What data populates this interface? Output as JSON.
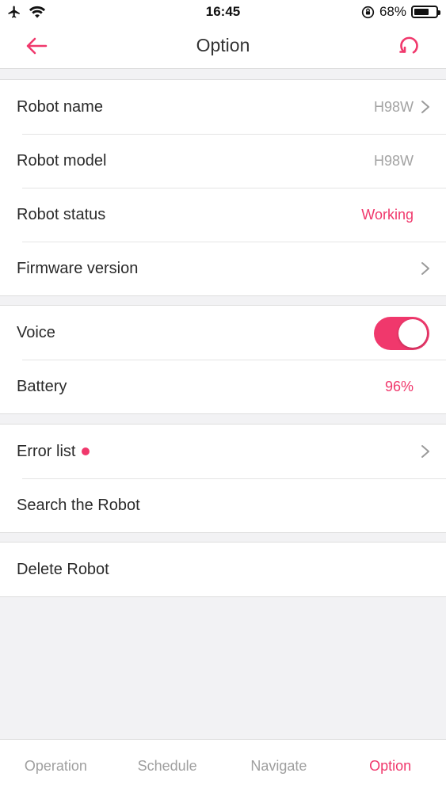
{
  "status_bar": {
    "time": "16:45",
    "battery_text": "68%",
    "battery_level": 0.68,
    "icons": [
      "airplane-icon",
      "wifi-icon",
      "orientation-lock-icon",
      "battery-icon"
    ]
  },
  "nav": {
    "title": "Option",
    "back_icon": "arrow-left-icon",
    "refresh_icon": "refresh-icon"
  },
  "sections": {
    "robot": {
      "name_label": "Robot name",
      "name_value": "H98W",
      "model_label": "Robot model",
      "model_value": "H98W",
      "status_label": "Robot status",
      "status_value": "Working",
      "firmware_label": "Firmware version"
    },
    "settings": {
      "voice_label": "Voice",
      "voice_on": true,
      "battery_label": "Battery",
      "battery_value": "96%"
    },
    "support": {
      "error_label": "Error list",
      "search_label": "Search the Robot"
    },
    "danger": {
      "delete_label": "Delete Robot"
    }
  },
  "tabs": [
    {
      "label": "Operation",
      "active": false
    },
    {
      "label": "Schedule",
      "active": false
    },
    {
      "label": "Navigate",
      "active": false
    },
    {
      "label": "Option",
      "active": true
    }
  ],
  "colors": {
    "accent": "#f0386c",
    "muted_text": "#a3a3a3",
    "background": "#f2f2f4"
  }
}
